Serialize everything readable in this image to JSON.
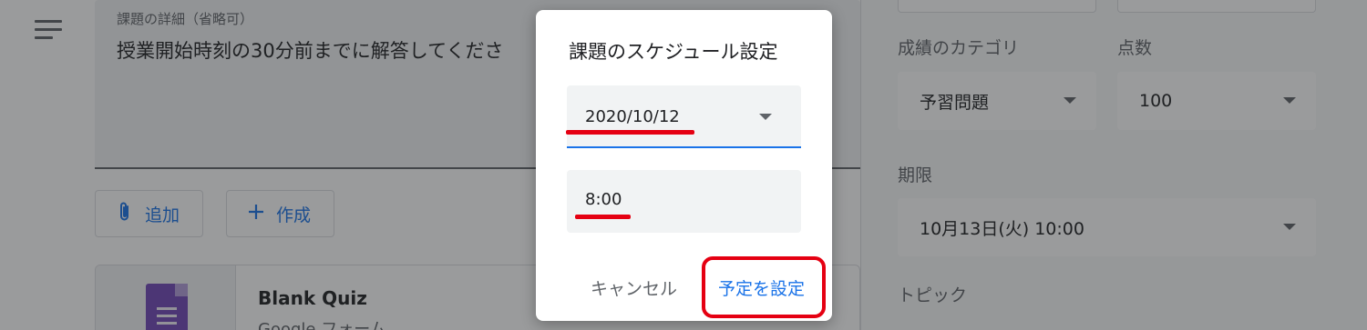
{
  "main": {
    "details_label": "課題の詳細（省略可）",
    "details_text": "授業開始時刻の30分前までに解答してくださ",
    "add_button": "追加",
    "create_button": "作成",
    "attachment": {
      "title": "Blank Quiz",
      "subtitle": "Google フォーム"
    }
  },
  "right_panel": {
    "category_label": "成績のカテゴリ",
    "category_value": "予習問題",
    "points_label": "点数",
    "points_value": "100",
    "due_label": "期限",
    "due_value": "10月13日(火) 10:00",
    "topic_label": "トピック"
  },
  "dialog": {
    "title": "課題のスケジュール設定",
    "date_value": "2020/10/12",
    "time_value": "8:00",
    "cancel_label": "キャンセル",
    "confirm_label": "予定を設定"
  },
  "colors": {
    "accent": "#1a73e8",
    "highlight": "#e50012",
    "forms_purple": "#7248b9"
  },
  "icons": {
    "menu": "menu-icon",
    "add": "paperclip-icon",
    "create": "plus-icon",
    "forms": "google-forms-icon"
  }
}
